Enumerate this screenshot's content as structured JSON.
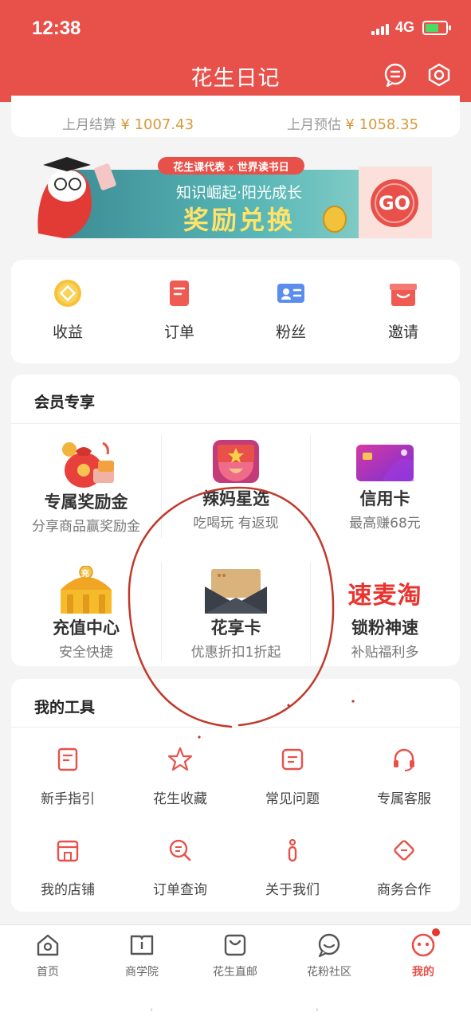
{
  "status_bar": {
    "time": "12:38",
    "network": "4G"
  },
  "nav": {
    "title": "花生日记",
    "message_icon": "message-icon",
    "settings_icon": "settings-hex-icon"
  },
  "settlement": {
    "last_month_settled_label": "上月结算",
    "last_month_settled_value": "¥ 1007.43",
    "last_month_estimate_label": "上月预估",
    "last_month_estimate_value": "¥ 1058.35"
  },
  "banner": {
    "tag": "花生课代表",
    "tag_x": "x",
    "tag_partner": "世界读书日",
    "slogan": "知识崛起·阳光成长",
    "headline": "奖励兑换",
    "button": "GO"
  },
  "quick_actions": [
    {
      "label": "收益",
      "icon": "coin-icon"
    },
    {
      "label": "订单",
      "icon": "order-icon"
    },
    {
      "label": "粉丝",
      "icon": "fans-card-icon"
    },
    {
      "label": "邀请",
      "icon": "gift-invite-icon"
    }
  ],
  "member": {
    "title": "会员专享",
    "items": [
      {
        "title": "专属奖励金",
        "sub": "分享商品赢奖励金",
        "icon": "money-bag-icon"
      },
      {
        "title": "辣妈星选",
        "sub": "吃喝玩 有返现",
        "icon": "gift-box-icon"
      },
      {
        "title": "信用卡",
        "sub": "最高赚68元",
        "icon": "credit-card-icon"
      },
      {
        "title": "充值中心",
        "sub": "安全快捷",
        "icon": "recharge-building-icon",
        "badge": "充"
      },
      {
        "title": "花享卡",
        "sub": "优惠折扣1折起",
        "icon": "envelope-card-icon"
      },
      {
        "title": "锁粉神速",
        "sub": "补贴福利多",
        "icon": "sumaitao-logo",
        "logo_text": "速麦淘"
      }
    ]
  },
  "tools": {
    "title": "我的工具",
    "items": [
      {
        "label": "新手指引",
        "icon": "guide-icon"
      },
      {
        "label": "花生收藏",
        "icon": "star-icon"
      },
      {
        "label": "常见问题",
        "icon": "faq-icon"
      },
      {
        "label": "专属客服",
        "icon": "headset-icon"
      },
      {
        "label": "我的店铺",
        "icon": "store-icon"
      },
      {
        "label": "订单查询",
        "icon": "order-search-icon"
      },
      {
        "label": "关于我们",
        "icon": "info-icon"
      },
      {
        "label": "商务合作",
        "icon": "handshake-icon"
      }
    ]
  },
  "tabbar": {
    "items": [
      {
        "label": "首页",
        "icon": "home-icon",
        "active": false
      },
      {
        "label": "商学院",
        "icon": "book-icon",
        "active": false
      },
      {
        "label": "花生直邮",
        "icon": "shopping-bag-icon",
        "active": false
      },
      {
        "label": "花粉社区",
        "icon": "chat-bubble-icon",
        "active": false
      },
      {
        "label": "我的",
        "icon": "profile-face-icon",
        "active": true
      }
    ]
  },
  "colors": {
    "brand": "#e8514a",
    "amount": "#d89a3a",
    "background": "#f4f4f4"
  }
}
